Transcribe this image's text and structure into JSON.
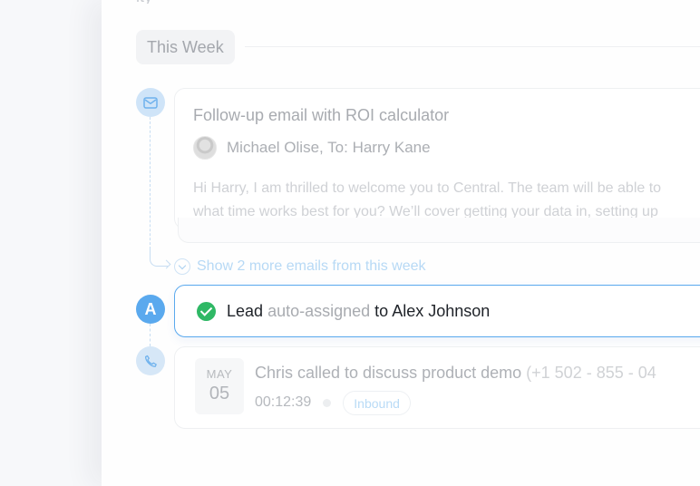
{
  "header": {
    "top_fragment": "ity",
    "week_label": "This Week"
  },
  "email": {
    "title": "Follow-up email with ROI calculator",
    "sender_line": "Michael Olise, To: Harry Kane",
    "body_line1": "Hi Harry, I am thrilled to welcome you to Central. The team will be able to",
    "body_line2": "what time works best for you? We’ll cover getting your data in, setting up"
  },
  "show_more": {
    "label": "Show 2 more emails from this week"
  },
  "lead": {
    "avatar_letter": "A",
    "text_start": "Lead",
    "text_muted": "auto-assigned",
    "text_end": "to Alex Johnson"
  },
  "call": {
    "month": "MAY",
    "day": "05",
    "title": "Chris called to discuss product demo",
    "phone": "(+1 502 - 855 - 04",
    "duration": "00:12:39",
    "badge": "Inbound"
  },
  "colors": {
    "accent": "#5aa9ee",
    "success": "#2fb865",
    "muted_text": "#a8abb0"
  }
}
